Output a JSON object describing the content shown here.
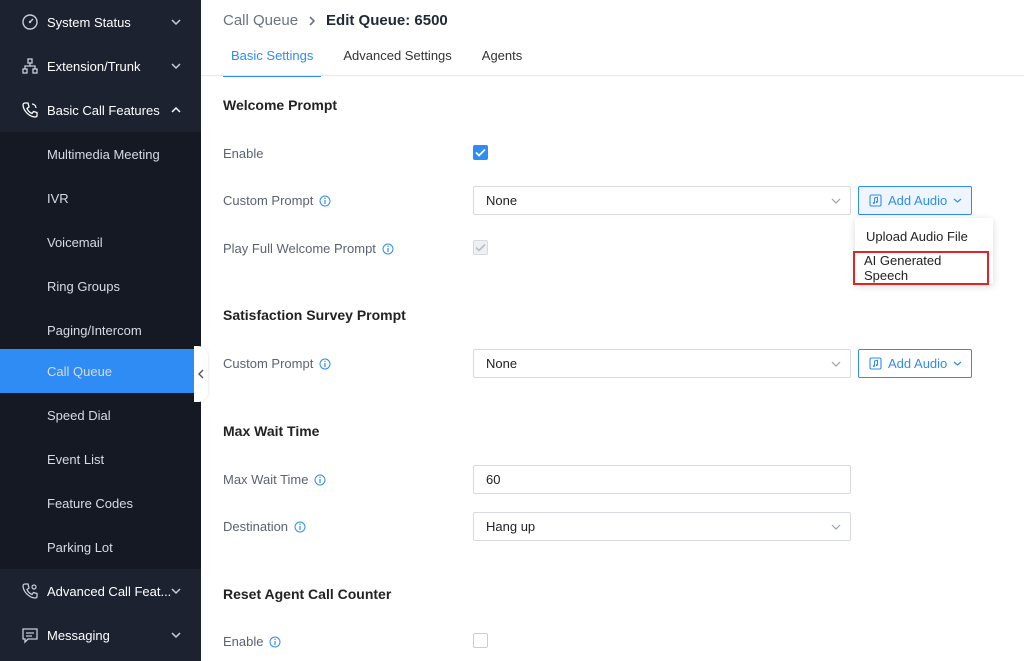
{
  "sidebar": {
    "items": [
      {
        "label": "System Status",
        "icon": "gauge-icon",
        "type": "top",
        "expanded": false
      },
      {
        "label": "Extension/Trunk",
        "icon": "network-icon",
        "type": "top",
        "expanded": false
      },
      {
        "label": "Basic Call Features",
        "icon": "phone-icon",
        "type": "top",
        "expanded": true
      },
      {
        "label": "Multimedia Meeting",
        "type": "sub"
      },
      {
        "label": "IVR",
        "type": "sub"
      },
      {
        "label": "Voicemail",
        "type": "sub"
      },
      {
        "label": "Ring Groups",
        "type": "sub"
      },
      {
        "label": "Paging/Intercom",
        "type": "sub"
      },
      {
        "label": "Call Queue",
        "type": "sub",
        "active": true
      },
      {
        "label": "Speed Dial",
        "type": "sub"
      },
      {
        "label": "Event List",
        "type": "sub"
      },
      {
        "label": "Feature Codes",
        "type": "sub"
      },
      {
        "label": "Parking Lot",
        "type": "sub"
      },
      {
        "label": "Advanced Call Feat...",
        "icon": "phone-settings-icon",
        "type": "top",
        "expanded": false
      },
      {
        "label": "Messaging",
        "icon": "message-icon",
        "type": "top",
        "expanded": false
      }
    ]
  },
  "header": {
    "breadcrumb_parent": "Call Queue",
    "breadcrumb_current": "Edit Queue: 6500"
  },
  "tabs": [
    {
      "label": "Basic Settings",
      "active": true
    },
    {
      "label": "Advanced Settings",
      "active": false
    },
    {
      "label": "Agents",
      "active": false
    }
  ],
  "welcome": {
    "title": "Welcome Prompt",
    "enable_label": "Enable",
    "enable_checked": true,
    "custom_prompt_label": "Custom Prompt",
    "custom_prompt_value": "None",
    "add_audio_label": "Add Audio",
    "play_full_label": "Play Full Welcome Prompt",
    "play_full_checked": true
  },
  "add_audio_menu": {
    "items": [
      "Upload Audio File",
      "AI Generated Speech"
    ]
  },
  "survey": {
    "title": "Satisfaction Survey Prompt",
    "custom_prompt_label": "Custom Prompt",
    "custom_prompt_value": "None",
    "add_audio_label": "Add Audio"
  },
  "max_wait": {
    "title": "Max Wait Time",
    "max_wait_label": "Max Wait Time",
    "max_wait_value": "60",
    "destination_label": "Destination",
    "destination_value": "Hang up"
  },
  "reset_counter": {
    "title": "Reset Agent Call Counter",
    "enable_label": "Enable",
    "enable_checked": false
  },
  "colors": {
    "sidebar_bg": "#1c2230",
    "accent": "#2f8cf5",
    "highlight_border": "#e02424"
  }
}
